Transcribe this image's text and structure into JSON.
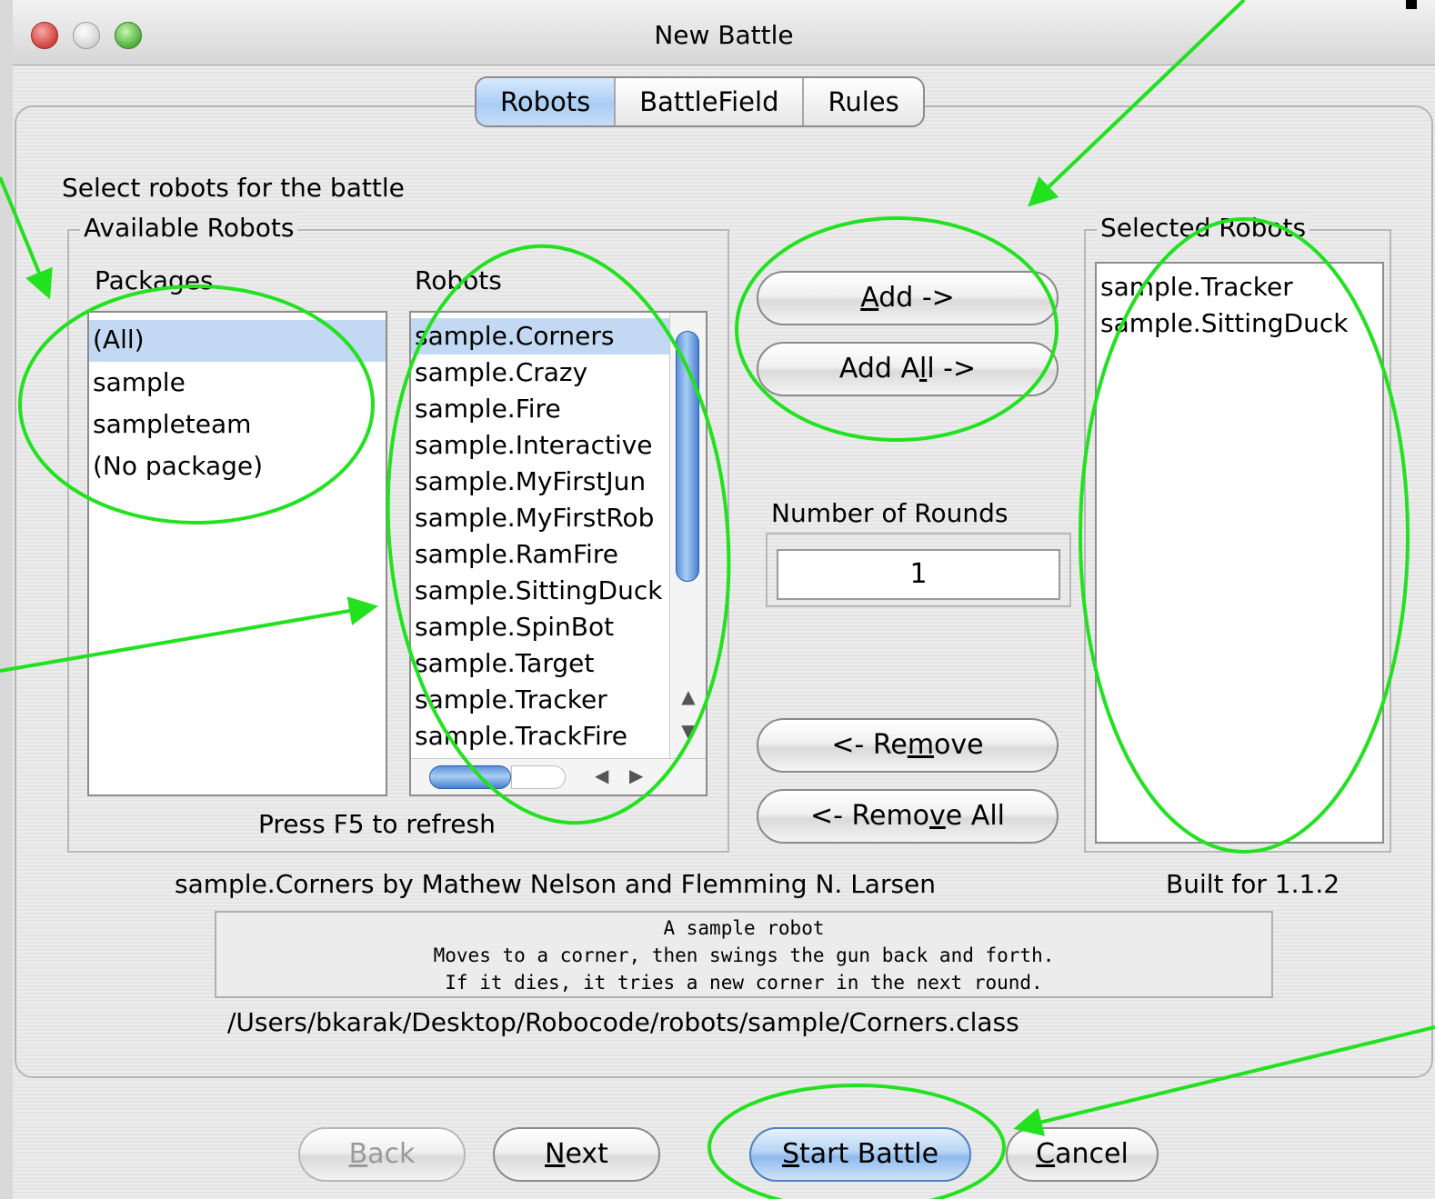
{
  "window": {
    "title": "New Battle"
  },
  "tabs": [
    {
      "label": "Robots",
      "active": true
    },
    {
      "label": "BattleField",
      "active": false
    },
    {
      "label": "Rules",
      "active": false
    }
  ],
  "instruction": "Select robots for the battle",
  "available": {
    "legend": "Available Robots",
    "packages_header": "Packages",
    "robots_header": "Robots",
    "packages": [
      "(All)",
      "sample",
      "sampleteam",
      "(No package)"
    ],
    "selected_package": "(All)",
    "robots": [
      "sample.Corners",
      "sample.Crazy",
      "sample.Fire",
      "sample.Interactive",
      "sample.MyFirstJun",
      "sample.MyFirstRob",
      "sample.RamFire",
      "sample.SittingDuck",
      "sample.SpinBot",
      "sample.Target",
      "sample.Tracker",
      "sample.TrackFire"
    ],
    "selected_robot": "sample.Corners",
    "refresh_hint": "Press F5 to refresh"
  },
  "buttons": {
    "add_pre": "",
    "add_ul": "A",
    "add_post": "dd ->",
    "add_all_pre": "Add A",
    "add_all_ul": "l",
    "add_all_post": "l ->",
    "remove_pre": "<- Re",
    "remove_ul": "m",
    "remove_post": "ove",
    "remove_all_pre": "<- Remo",
    "remove_all_ul": "v",
    "remove_all_post": "e All",
    "back_ul": "B",
    "back_post": "ack",
    "next_ul": "N",
    "next_post": "ext",
    "start_ul": "S",
    "start_post": "tart Battle",
    "cancel_ul": "C",
    "cancel_post": "ancel"
  },
  "rounds": {
    "label": "Number of Rounds",
    "value": "1"
  },
  "selected": {
    "legend": "Selected Robots",
    "robots": [
      "sample.Tracker",
      "sample.SittingDuck"
    ]
  },
  "details": {
    "author_line": "sample.Corners by Mathew Nelson and Flemming N. Larsen",
    "built_for": "Built for 1.1.2",
    "description": [
      "A sample robot",
      "Moves to a corner, then swings the gun back and forth.",
      "If it dies, it tries a new corner in the next round."
    ],
    "path": "/Users/bkarak/Desktop/Robocode/robots/sample/Corners.class"
  },
  "colors": {
    "annotation": "#22e11f",
    "selection": "#c3d9f3",
    "scroll_thumb": "#5b90d8"
  }
}
